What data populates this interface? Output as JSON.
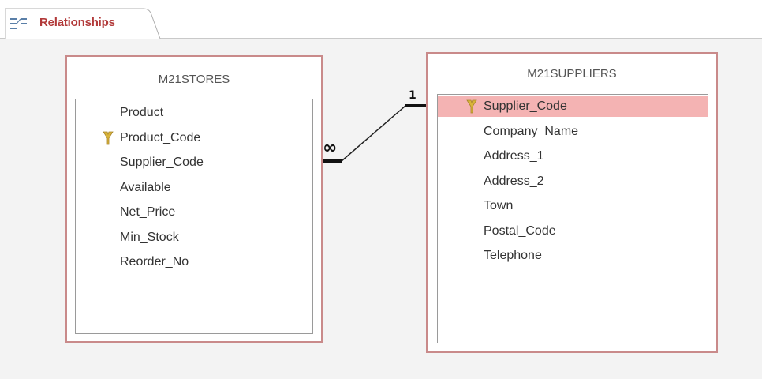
{
  "tab": {
    "label": "Relationships",
    "icon": "relationships-icon"
  },
  "tables": [
    {
      "name": "M21STORES",
      "fields": [
        {
          "label": "Product",
          "primary_key": false
        },
        {
          "label": "Product_Code",
          "primary_key": true
        },
        {
          "label": "Supplier_Code",
          "primary_key": false
        },
        {
          "label": "Available",
          "primary_key": false
        },
        {
          "label": "Net_Price",
          "primary_key": false
        },
        {
          "label": "Min_Stock",
          "primary_key": false
        },
        {
          "label": "Reorder_No",
          "primary_key": false
        }
      ]
    },
    {
      "name": "M21SUPPLIERS",
      "fields": [
        {
          "label": "Supplier_Code",
          "primary_key": true,
          "selected": true
        },
        {
          "label": "Company_Name",
          "primary_key": false
        },
        {
          "label": "Address_1",
          "primary_key": false
        },
        {
          "label": "Address_2",
          "primary_key": false
        },
        {
          "label": "Town",
          "primary_key": false
        },
        {
          "label": "Postal_Code",
          "primary_key": false
        },
        {
          "label": "Telephone",
          "primary_key": false
        }
      ]
    }
  ],
  "relationship": {
    "from_table": "M21STORES",
    "to_table": "M21SUPPLIERS",
    "many_symbol": "∞",
    "one_symbol": "1"
  },
  "colors": {
    "table_border": "#c98a8a",
    "selected_row": "#f4b3b3",
    "tab_text": "#b23a3a",
    "key_icon": "#d9b43a"
  }
}
